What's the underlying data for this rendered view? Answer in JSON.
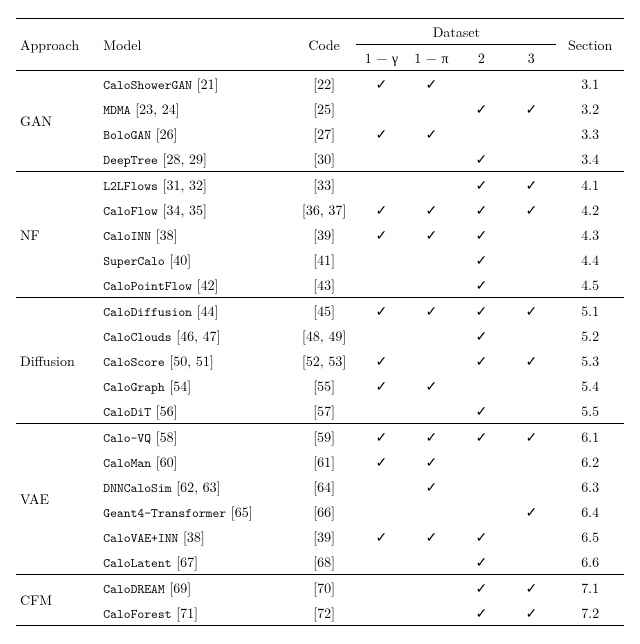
{
  "header": {
    "approach": "Approach",
    "model": "Model",
    "code": "Code",
    "dataset": "Dataset",
    "ds1": "1 − γ",
    "ds2": "1 − π",
    "ds3": "2",
    "ds4": "3",
    "section": "Section"
  },
  "groups": [
    {
      "name": "GAN",
      "rows": [
        {
          "model": "CaloShowerGAN",
          "ref": "[21]",
          "code": "[22]",
          "d": [
            true,
            true,
            false,
            false
          ],
          "section": "3.1"
        },
        {
          "model": "MDMA",
          "ref": "[23, 24]",
          "code": "[25]",
          "d": [
            false,
            false,
            true,
            true
          ],
          "section": "3.2"
        },
        {
          "model": "BoloGAN",
          "ref": "[26]",
          "code": "[27]",
          "d": [
            true,
            true,
            false,
            false
          ],
          "section": "3.3"
        },
        {
          "model": "DeepTree",
          "ref": "[28, 29]",
          "code": "[30]",
          "d": [
            false,
            false,
            true,
            false
          ],
          "section": "3.4"
        }
      ]
    },
    {
      "name": "NF",
      "rows": [
        {
          "model": "L2LFlows",
          "ref": "[31, 32]",
          "code": "[33]",
          "d": [
            false,
            false,
            true,
            true
          ],
          "section": "4.1"
        },
        {
          "model": "CaloFlow",
          "ref": "[34, 35]",
          "code": "[36, 37]",
          "d": [
            true,
            true,
            true,
            true
          ],
          "section": "4.2"
        },
        {
          "model": "CaloINN",
          "ref": "[38]",
          "code": "[39]",
          "d": [
            true,
            true,
            true,
            false
          ],
          "section": "4.3"
        },
        {
          "model": "SuperCalo",
          "ref": "[40]",
          "code": "[41]",
          "d": [
            false,
            false,
            true,
            false
          ],
          "section": "4.4"
        },
        {
          "model": "CaloPointFlow",
          "ref": "[42]",
          "code": "[43]",
          "d": [
            false,
            false,
            true,
            false
          ],
          "section": "4.5"
        }
      ]
    },
    {
      "name": "Diffusion",
      "rows": [
        {
          "model": "CaloDiffusion",
          "ref": "[44]",
          "code": "[45]",
          "d": [
            true,
            true,
            true,
            true
          ],
          "section": "5.1"
        },
        {
          "model": "CaloClouds",
          "ref": "[46, 47]",
          "code": "[48, 49]",
          "d": [
            false,
            false,
            true,
            false
          ],
          "section": "5.2"
        },
        {
          "model": "CaloScore",
          "ref": "[50, 51]",
          "code": "[52, 53]",
          "d": [
            true,
            false,
            true,
            true
          ],
          "section": "5.3"
        },
        {
          "model": "CaloGraph",
          "ref": "[54]",
          "code": "[55]",
          "d": [
            true,
            true,
            false,
            false
          ],
          "section": "5.4"
        },
        {
          "model": "CaloDiT",
          "ref": "[56]",
          "code": "[57]",
          "d": [
            false,
            false,
            true,
            false
          ],
          "section": "5.5"
        }
      ]
    },
    {
      "name": "VAE",
      "rows": [
        {
          "model": "Calo-VQ",
          "ref": "[58]",
          "code": "[59]",
          "d": [
            true,
            true,
            true,
            true
          ],
          "section": "6.1"
        },
        {
          "model": "CaloMan",
          "ref": "[60]",
          "code": "[61]",
          "d": [
            true,
            true,
            false,
            false
          ],
          "section": "6.2"
        },
        {
          "model": "DNNCaloSim",
          "ref": "[62, 63]",
          "code": "[64]",
          "d": [
            false,
            true,
            false,
            false
          ],
          "section": "6.3"
        },
        {
          "model": "Geant4-Transformer",
          "ref": "[65]",
          "code": "[66]",
          "d": [
            false,
            false,
            false,
            true
          ],
          "section": "6.4"
        },
        {
          "model": "CaloVAE+INN",
          "ref": "[38]",
          "code": "[39]",
          "d": [
            true,
            true,
            true,
            false
          ],
          "section": "6.5"
        },
        {
          "model": "CaloLatent",
          "ref": "[67]",
          "code": "[68]",
          "d": [
            false,
            false,
            true,
            false
          ],
          "section": "6.6"
        }
      ]
    },
    {
      "name": "CFM",
      "rows": [
        {
          "model": "CaloDREAM",
          "ref": "[69]",
          "code": "[70]",
          "d": [
            false,
            false,
            true,
            true
          ],
          "section": "7.1"
        },
        {
          "model": "CaloForest",
          "ref": "[71]",
          "code": "[72]",
          "d": [
            false,
            false,
            true,
            true
          ],
          "section": "7.2"
        }
      ]
    }
  ]
}
